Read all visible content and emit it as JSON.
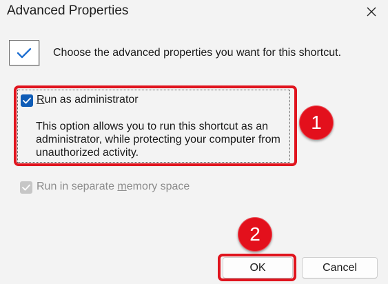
{
  "dialog": {
    "title": "Advanced Properties"
  },
  "header": {
    "text": "Choose the advanced properties you want for this shortcut."
  },
  "options": {
    "run_as_admin": {
      "label_accesskey": "R",
      "label_rest": "un as administrator",
      "checked": true,
      "description": "This option allows you to run this shortcut as an administrator, while protecting your computer from unauthorized activity."
    },
    "separate_memory": {
      "label_before": "Run in separate ",
      "label_accesskey": "m",
      "label_after": "emory space",
      "checked": true,
      "disabled": true
    }
  },
  "buttons": {
    "ok": "OK",
    "cancel": "Cancel"
  },
  "annotations": {
    "step1": "1",
    "step2": "2"
  },
  "colors": {
    "highlight": "#e0141e",
    "checkbox_accent": "#0f5cb6",
    "header_check": "#1f6fd1"
  },
  "icons": {
    "close": "close-icon",
    "header": "checkmark-icon",
    "checkbox_mark": "checkmark-icon"
  }
}
